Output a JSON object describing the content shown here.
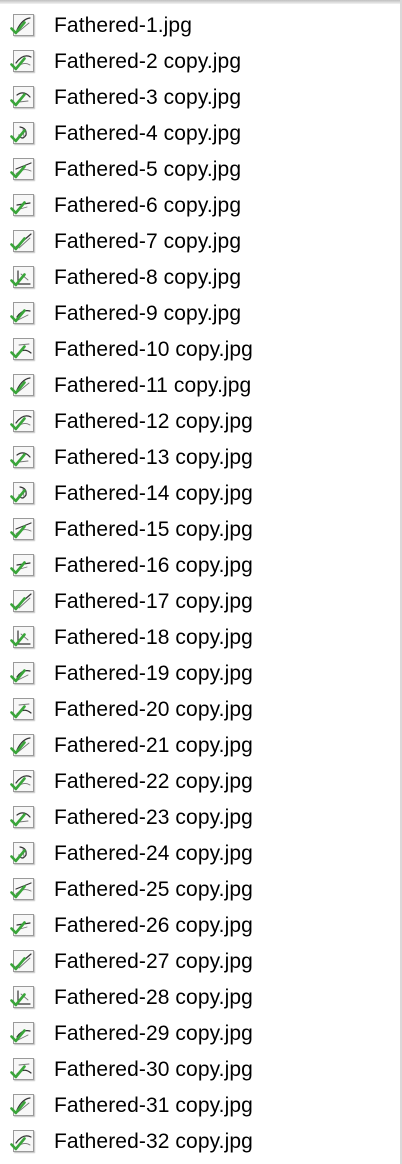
{
  "files": [
    {
      "name": "Fathered-1.jpg",
      "status": "synced"
    },
    {
      "name": "Fathered-2 copy.jpg",
      "status": "synced"
    },
    {
      "name": "Fathered-3 copy.jpg",
      "status": "synced"
    },
    {
      "name": "Fathered-4 copy.jpg",
      "status": "synced"
    },
    {
      "name": "Fathered-5 copy.jpg",
      "status": "synced"
    },
    {
      "name": "Fathered-6 copy.jpg",
      "status": "synced"
    },
    {
      "name": "Fathered-7 copy.jpg",
      "status": "synced"
    },
    {
      "name": "Fathered-8 copy.jpg",
      "status": "synced"
    },
    {
      "name": "Fathered-9 copy.jpg",
      "status": "synced"
    },
    {
      "name": "Fathered-10 copy.jpg",
      "status": "synced"
    },
    {
      "name": "Fathered-11 copy.jpg",
      "status": "synced"
    },
    {
      "name": "Fathered-12 copy.jpg",
      "status": "synced"
    },
    {
      "name": "Fathered-13 copy.jpg",
      "status": "synced"
    },
    {
      "name": "Fathered-14 copy.jpg",
      "status": "synced"
    },
    {
      "name": "Fathered-15 copy.jpg",
      "status": "synced"
    },
    {
      "name": "Fathered-16 copy.jpg",
      "status": "synced"
    },
    {
      "name": "Fathered-17 copy.jpg",
      "status": "synced"
    },
    {
      "name": "Fathered-18 copy.jpg",
      "status": "synced"
    },
    {
      "name": "Fathered-19 copy.jpg",
      "status": "synced"
    },
    {
      "name": "Fathered-20 copy.jpg",
      "status": "synced"
    },
    {
      "name": "Fathered-21 copy.jpg",
      "status": "synced"
    },
    {
      "name": "Fathered-22 copy.jpg",
      "status": "synced"
    },
    {
      "name": "Fathered-23 copy.jpg",
      "status": "synced"
    },
    {
      "name": "Fathered-24 copy.jpg",
      "status": "synced"
    },
    {
      "name": "Fathered-25 copy.jpg",
      "status": "synced"
    },
    {
      "name": "Fathered-26 copy.jpg",
      "status": "synced"
    },
    {
      "name": "Fathered-27 copy.jpg",
      "status": "synced"
    },
    {
      "name": "Fathered-28 copy.jpg",
      "status": "synced"
    },
    {
      "name": "Fathered-29 copy.jpg",
      "status": "synced"
    },
    {
      "name": "Fathered-30 copy.jpg",
      "status": "synced"
    },
    {
      "name": "Fathered-31 copy.jpg",
      "status": "synced"
    },
    {
      "name": "Fathered-32 copy.jpg",
      "status": "synced"
    }
  ],
  "icons": {
    "thumbnail": "image-file-thumbnail-icon",
    "status": "green-checkmark-icon"
  },
  "colors": {
    "check": "#3aa53a",
    "text": "#000000"
  }
}
